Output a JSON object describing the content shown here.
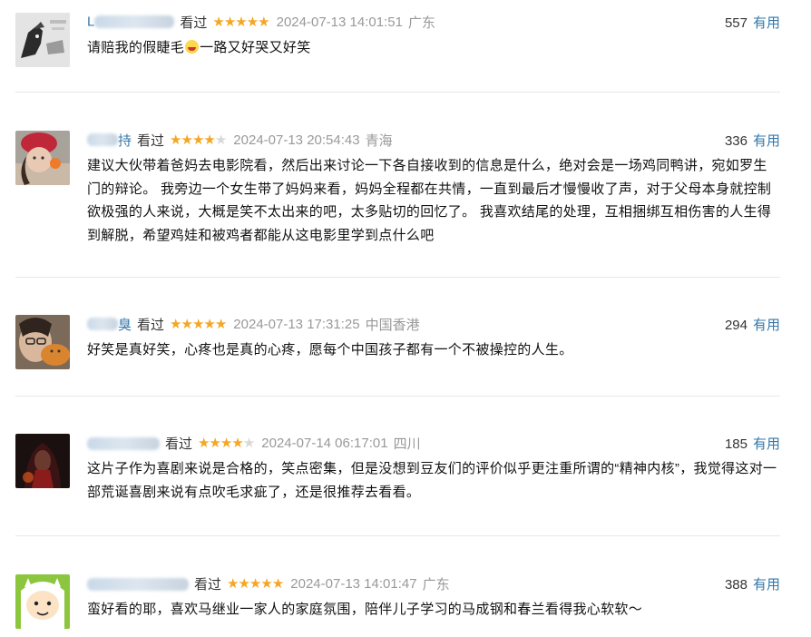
{
  "status_text": "看过",
  "useful_label": "有用",
  "comments": [
    {
      "user_visible_prefix": "L",
      "user_visible_suffix": "",
      "stars": 5,
      "time": "2024-07-13 14:01:51",
      "location": "广东",
      "votes": "557",
      "content_before_emoji": "请赔我的假睫毛",
      "emoji": "laughing-tears-emoji",
      "content_after_emoji": "一路又好哭又好笑"
    },
    {
      "user_visible_prefix": "",
      "user_visible_suffix": "持",
      "stars": 4,
      "time": "2024-07-13 20:54:43",
      "location": "青海",
      "votes": "336",
      "content": "建议大伙带着爸妈去电影院看，然后出来讨论一下各自接收到的信息是什么，绝对会是一场鸡同鸭讲，宛如罗生门的辩论。 我旁边一个女生带了妈妈来看，妈妈全程都在共情，一直到最后才慢慢收了声，对于父母本身就控制欲极强的人来说，大概是笑不太出来的吧，太多贴切的回忆了。 我喜欢结尾的处理，互相捆绑互相伤害的人生得到解脱，希望鸡娃和被鸡者都能从这电影里学到点什么吧"
    },
    {
      "user_visible_prefix": "",
      "user_visible_suffix": "臭",
      "stars": 5,
      "time": "2024-07-13 17:31:25",
      "location": "中国香港",
      "votes": "294",
      "content": "好笑是真好笑，心疼也是真的心疼，愿每个中国孩子都有一个不被操控的人生。"
    },
    {
      "user_visible_prefix": "",
      "user_visible_suffix": "",
      "stars": 4,
      "time": "2024-07-14 06:17:01",
      "location": "四川",
      "votes": "185",
      "content": "这片子作为喜剧来说是合格的，笑点密集，但是没想到豆友们的评价似乎更注重所谓的“精神内核”，我觉得这对一部荒诞喜剧来说有点吹毛求疵了，还是很推荐去看看。"
    },
    {
      "user_visible_prefix": "",
      "user_visible_suffix": "",
      "stars": 5,
      "time": "2024-07-13 14:01:47",
      "location": "广东",
      "votes": "388",
      "content": "蛮好看的耶，喜欢马继业一家人的家庭氛围，陪伴儿子学习的马成钢和春兰看得我心软软～"
    }
  ],
  "colors": {
    "link": "#3377aa",
    "star_on": "#f5a623",
    "star_off": "#d8d8d8",
    "meta_gray": "#999999",
    "divider": "#e8e8e8"
  }
}
